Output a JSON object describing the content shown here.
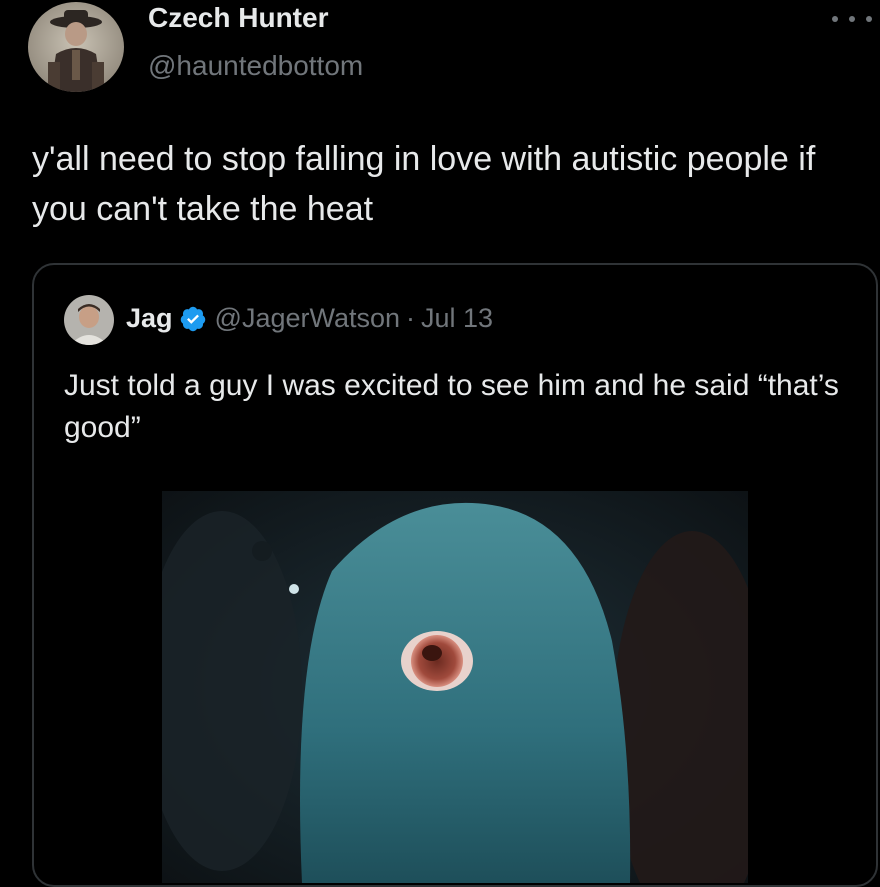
{
  "author": {
    "display_name": "Czech Hunter",
    "handle": "@hauntedbottom"
  },
  "tweet": {
    "text": "y'all need to stop falling in love with autistic people if you can't take the heat"
  },
  "quoted_tweet": {
    "display_name": "Jag",
    "handle": "@JagerWatson",
    "separator": "·",
    "date": "Jul 13",
    "text": "Just told a guy I was excited to see him and he said “that’s good”",
    "verified": true
  },
  "icons": {
    "more": "more-horizontal-icon",
    "verified": "verified-badge-icon"
  },
  "colors": {
    "background": "#000000",
    "text_primary": "#e7e9ea",
    "text_secondary": "#71767b",
    "border": "#2f3336",
    "verified": "#1d9bf0"
  }
}
